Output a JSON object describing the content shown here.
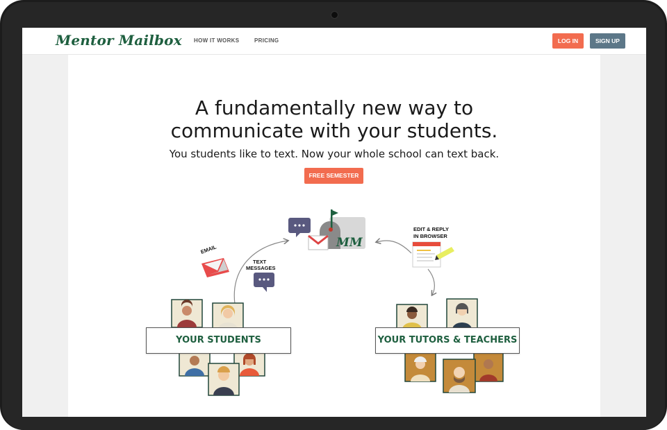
{
  "nav": {
    "logo": "Mentor Mailbox",
    "links": [
      "HOW IT WORKS",
      "PRICING"
    ],
    "login": "LOG IN",
    "signup": "SIGN UP"
  },
  "hero": {
    "headline_line1": "A fundamentally new way to",
    "headline_line2": "communicate with your students.",
    "subline": "You students like to text. Now your whole school can text back.",
    "cta": "FREE SEMESTER"
  },
  "diagram": {
    "email_label": "EMAIL",
    "text_label_1": "TEXT",
    "text_label_2": "MESSAGES",
    "browser_label_1": "EDIT & REPLY",
    "browser_label_2": "IN BROWSER",
    "mailbox_letters": "MM",
    "students_label": "YOUR STUDENTS",
    "teachers_label": "YOUR TUTORS & TEACHERS"
  },
  "colors": {
    "brand_green": "#1e5f3f",
    "accent_orange": "#f26c4f",
    "signup_slate": "#5c7788",
    "bubble_purple": "#59597f"
  }
}
